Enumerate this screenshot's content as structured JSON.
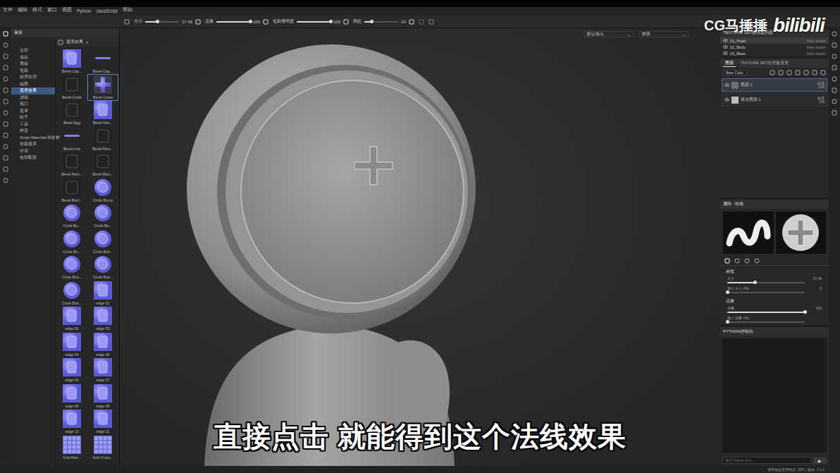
{
  "menu": [
    "文件",
    "编辑",
    "模式",
    "窗口",
    "视图",
    "Python",
    "JavaScript",
    "帮助"
  ],
  "toolbar": {
    "sliders": [
      {
        "label": "大小",
        "value": "17.46",
        "level": 0.35
      },
      {
        "label": "流量",
        "value": "100",
        "level": 1
      },
      {
        "label": "笔刷透明度",
        "value": "100",
        "level": 1
      },
      {
        "label": "间距",
        "value": "20",
        "level": 0.2
      }
    ]
  },
  "shelf": {
    "title": "展架",
    "tab": "遮罩效果",
    "tab_close": "×",
    "categories": [
      {
        "label": "全部",
        "selected": false
      },
      {
        "label": "项目",
        "selected": false
      },
      {
        "label": "透贴",
        "selected": false
      },
      {
        "label": "笔刷",
        "selected": false
      },
      {
        "label": "程序纹理",
        "selected": false
      },
      {
        "label": "贴图",
        "selected": false
      },
      {
        "label": "遮罩效果",
        "selected": true
      },
      {
        "label": "滤镜",
        "selected": false
      },
      {
        "label": "视口",
        "selected": false
      },
      {
        "label": "遮罩",
        "selected": false
      },
      {
        "label": "粒子",
        "selected": false
      },
      {
        "label": "工具",
        "selected": false
      },
      {
        "label": "材质",
        "selected": false
      },
      {
        "label": "Smart Materials智能材",
        "selected": false
      },
      {
        "label": "智能遮罩",
        "selected": false
      },
      {
        "label": "环境",
        "selected": false
      },
      {
        "label": "色彩配置",
        "selected": false
      }
    ],
    "items": [
      {
        "label": "Bevel Cap...",
        "kind": "normal",
        "selected": false
      },
      {
        "label": "Bevel Cap...",
        "kind": "line",
        "selected": false
      },
      {
        "label": "Bevel Circle",
        "kind": "outline",
        "selected": false
      },
      {
        "label": "Bevel Cross",
        "kind": "cross",
        "selected": true
      },
      {
        "label": "Bevel Egg",
        "kind": "outline",
        "selected": false
      },
      {
        "label": "Bevel Hex...",
        "kind": "normal",
        "selected": false
      },
      {
        "label": "Bevel Line",
        "kind": "line",
        "selected": false
      },
      {
        "label": "Bevel Rect...",
        "kind": "outline",
        "selected": false
      },
      {
        "label": "Bevel Rect...",
        "kind": "outline",
        "selected": false
      },
      {
        "label": "Bevel Rect...",
        "kind": "outline",
        "selected": false
      },
      {
        "label": "Bevel Rect...",
        "kind": "outline",
        "selected": false
      },
      {
        "label": "Circle Bump",
        "kind": "circle",
        "selected": false
      },
      {
        "label": "Circle Bu...",
        "kind": "circle",
        "selected": false
      },
      {
        "label": "Circle Bu...",
        "kind": "circle",
        "selected": false
      },
      {
        "label": "Circle Bu...",
        "kind": "circle",
        "selected": false
      },
      {
        "label": "Circle Butt...",
        "kind": "circle",
        "selected": false
      },
      {
        "label": "Circle Butt...",
        "kind": "circle",
        "selected": false
      },
      {
        "label": "Circle Butt...",
        "kind": "circle",
        "selected": false
      },
      {
        "label": "Circle Butt...",
        "kind": "circle",
        "selected": false
      },
      {
        "label": "edge 01",
        "kind": "normal",
        "selected": false
      },
      {
        "label": "edge 02",
        "kind": "normal",
        "selected": false
      },
      {
        "label": "edge 03",
        "kind": "normal",
        "selected": false
      },
      {
        "label": "edge 04",
        "kind": "normal",
        "selected": false
      },
      {
        "label": "edge 05",
        "kind": "normal",
        "selected": false
      },
      {
        "label": "edge 06",
        "kind": "normal",
        "selected": false
      },
      {
        "label": "edge 07",
        "kind": "normal",
        "selected": false
      },
      {
        "label": "edge 08",
        "kind": "normal",
        "selected": false
      },
      {
        "label": "edge 09",
        "kind": "normal",
        "selected": false
      },
      {
        "label": "edge 10",
        "kind": "normal",
        "selected": false
      },
      {
        "label": "edge 11",
        "kind": "normal",
        "selected": false
      },
      {
        "label": "Grid Alter...",
        "kind": "grid",
        "selected": false
      },
      {
        "label": "Grid Cross...",
        "kind": "grid",
        "selected": false
      }
    ]
  },
  "viewport": {
    "camera": "默认镜头",
    "mode": "材质",
    "subtitle": "直接点击 就能得到这个法线效果"
  },
  "watermark": {
    "author": "CG马捶捶",
    "site": "bilibili"
  },
  "texture_sets": {
    "title": "TEXTURE SET纹理集列表",
    "items": [
      {
        "name": "01_Head",
        "shader": "Main shader",
        "selected": true
      },
      {
        "name": "02_Body",
        "shader": "Main shader",
        "selected": false
      },
      {
        "name": "03_Base",
        "shader": "Main shader",
        "selected": false
      }
    ]
  },
  "layers": {
    "tabs": [
      {
        "label": "图层",
        "selected": true
      },
      {
        "label": "TEXTURE SET纹理集设置",
        "selected": false
      }
    ],
    "channel": "Base Color",
    "items": [
      {
        "name": "图层 1",
        "blend": "标准",
        "opacity": "100",
        "kind": "paint",
        "selected": true
      },
      {
        "name": "填充图层 1",
        "blend": "标准",
        "opacity": "100",
        "kind": "fill",
        "selected": false
      }
    ]
  },
  "properties": {
    "title": "属性 - 绘画",
    "sections": [
      {
        "title": "画笔",
        "fields": [
          {
            "label": "大小",
            "value": "17.46",
            "level": 0.35
          },
          {
            "label": "最小 大小 (%)",
            "value": "0",
            "level": 0
          }
        ]
      },
      {
        "title": "流量",
        "fields": [
          {
            "label": "流量",
            "value": "100",
            "level": 1
          },
          {
            "label": "最小 流量 (%)",
            "level": 0
          }
        ]
      }
    ]
  },
  "console": {
    "title": "PYTHON控制台",
    "placeholder": "执行 Python 命令...",
    "run": "▶"
  },
  "status": "缓存磁盘使用情况: 33% | 版本: 7.1.1"
}
